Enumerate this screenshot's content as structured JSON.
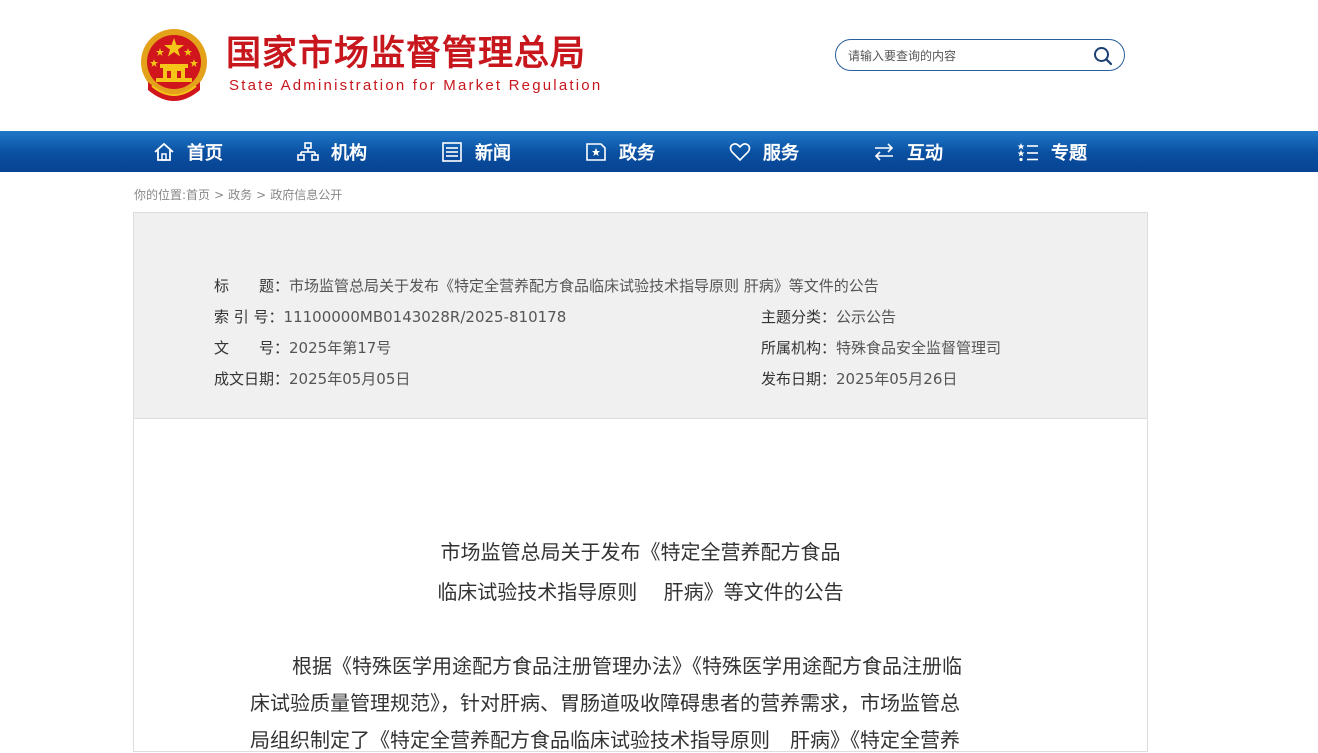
{
  "header": {
    "logo_cn": "国家市场监督管理总局",
    "logo_en": "State Administration for Market Regulation",
    "search": {
      "placeholder": "请输入要查询的内容"
    }
  },
  "nav": {
    "items": [
      {
        "label": "首页",
        "icon": "home-icon"
      },
      {
        "label": "机构",
        "icon": "org-chart-icon"
      },
      {
        "label": "新闻",
        "icon": "news-icon"
      },
      {
        "label": "政务",
        "icon": "government-affairs-icon"
      },
      {
        "label": "服务",
        "icon": "heart-icon"
      },
      {
        "label": "互动",
        "icon": "exchange-arrows-icon"
      },
      {
        "label": "专题",
        "icon": "topic-list-icon"
      }
    ]
  },
  "breadcrumb": {
    "prefix": "你的位置:",
    "items": [
      "首页",
      "政务",
      "政府信息公开"
    ],
    "separator": ">"
  },
  "meta": {
    "title_label": "标　　题：",
    "title_value": "市场监管总局关于发布《特定全营养配方食品临床试验技术指导原则 肝病》等文件的公告",
    "index_label": "索 引 号：",
    "index_value": "11100000MB0143028R/2025-810178",
    "category_label": "主题分类：",
    "category_value": "公示公告",
    "doc_no_label": "文　　号：",
    "doc_no_value": "2025年第17号",
    "org_label": "所属机构：",
    "org_value": "特殊食品安全监督管理司",
    "created_label": "成文日期：",
    "created_value": "2025年05月05日",
    "published_label": "发布日期：",
    "published_value": "2025年05月26日"
  },
  "article": {
    "title_line1": "市场监管总局关于发布《特定全营养配方食品",
    "title_line2": "临床试验技术指导原则　 肝病》等文件的公告",
    "body_line1": "根据《特殊医学用途配方食品注册管理办法》《特殊医学用途配方食品注册临",
    "body_line2": "床试验质量管理规范》，针对肝病、胃肠道吸收障碍患者的营养需求，市场监管总",
    "body_line3": "局组织制定了《特定全营养配方食品临床试验技术指导原则　肝病》《特定全营养"
  },
  "colors": {
    "brand_red": "#c8161d",
    "nav_blue": "#0a4fa0",
    "meta_bg": "#f0f0f0"
  }
}
